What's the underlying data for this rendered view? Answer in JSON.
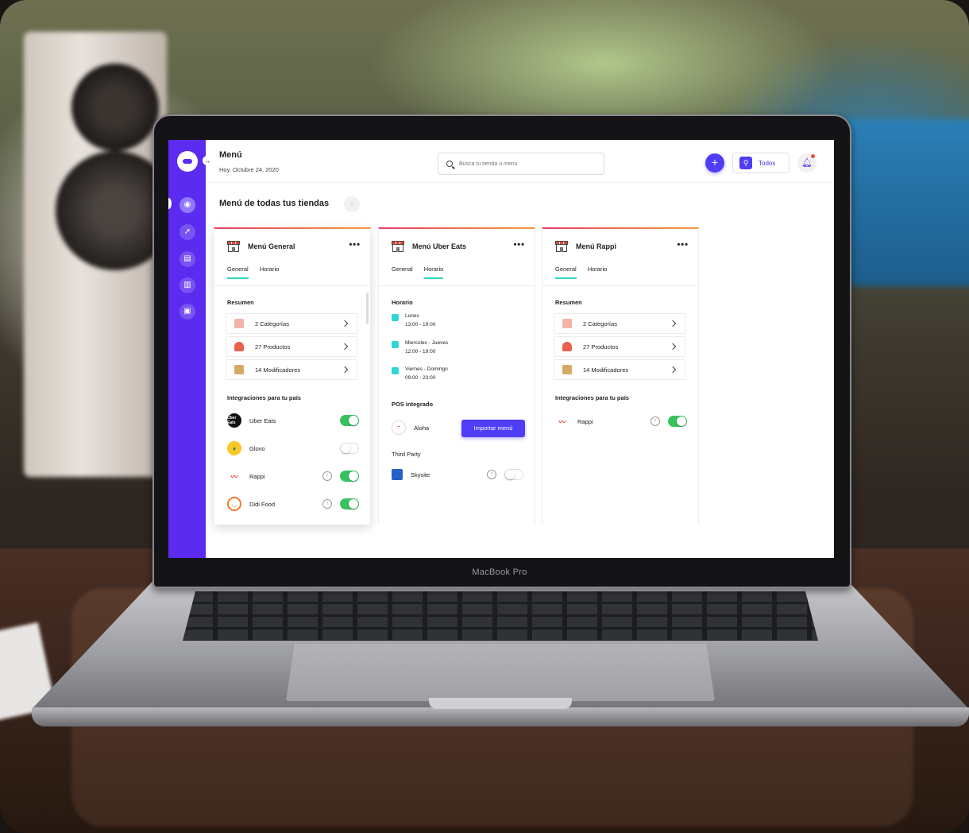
{
  "app": {
    "page_title": "Menú",
    "date": "Hoy, Octubre 24, 2020",
    "section_title": "Menú de todas tus tiendas",
    "device_label": "MacBook Pro"
  },
  "search": {
    "placeholder": "Busca tu tienda o menu"
  },
  "header": {
    "add_label": "+",
    "todos_label": "Todos"
  },
  "colors": {
    "sidebar": "#5b2cf0",
    "accent": "#4f3ef6",
    "tab_underline": "#2fd6c4",
    "toggle_on": "#37c25e"
  },
  "sidebar": {
    "items": [
      {
        "icon": "home-icon",
        "active": true
      },
      {
        "icon": "rocket-icon",
        "active": false
      },
      {
        "icon": "menu-book-icon",
        "active": false
      },
      {
        "icon": "chart-icon",
        "active": false
      },
      {
        "icon": "report-icon",
        "active": false
      }
    ]
  },
  "cards": [
    {
      "title": "Menú General",
      "tabs": [
        "General",
        "Horario"
      ],
      "active_tab": 0,
      "summary_title": "Resumen",
      "summary": [
        "2 Categorías",
        "27 Productos",
        "14 Modificadores"
      ],
      "integrations_title": "Integraciones para tu país",
      "integrations": [
        {
          "name": "Uber Eats",
          "brand_text": "Uber Eats",
          "upload": false,
          "enabled": true
        },
        {
          "name": "Glovo",
          "upload": false,
          "enabled": false
        },
        {
          "name": "Rappi",
          "upload": true,
          "enabled": true
        },
        {
          "name": "Didi Food",
          "upload": true,
          "enabled": true
        }
      ]
    },
    {
      "title": "Menú Uber Eats",
      "tabs": [
        "General",
        "Horario"
      ],
      "active_tab": 1,
      "schedule_title": "Horario",
      "schedule": [
        {
          "days": "Lunes",
          "hours": "13:00 - 19:00"
        },
        {
          "days": "Miercoles - Jueves",
          "hours": "12:00 - 19:00"
        },
        {
          "days": "Viernes - Domingo",
          "hours": "09:00 - 23:00"
        }
      ],
      "pos_title": "POS integrado",
      "pos": {
        "name": "Aloha",
        "button": "Importar menú"
      },
      "third_party_title": "Third Party",
      "third_party": {
        "name": "Skysite",
        "enabled": false
      }
    },
    {
      "title": "Menú Rappi",
      "tabs": [
        "General",
        "Horario"
      ],
      "active_tab": 0,
      "summary_title": "Resumen",
      "summary": [
        "2 Categorías",
        "27 Productos",
        "14 Modificadores"
      ],
      "integrations_title": "Integraciones para tu país",
      "integrations": [
        {
          "name": "Rappi",
          "upload": true,
          "enabled": true
        }
      ]
    }
  ]
}
